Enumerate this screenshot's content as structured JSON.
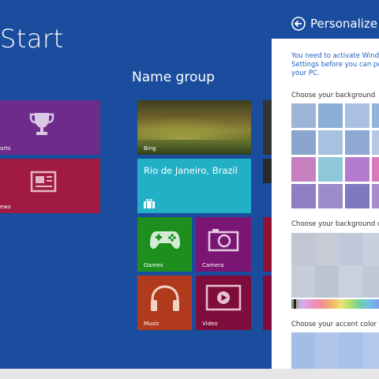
{
  "start": {
    "title": "Start",
    "group_name": "Name group"
  },
  "tiles": {
    "sports": {
      "label": "orts",
      "color": "#6e2b8c",
      "icon": "trophy-icon"
    },
    "news": {
      "label": "ews",
      "color": "#a01a43",
      "icon": "newspaper-icon"
    },
    "bing": {
      "label": "Bing"
    },
    "weather": {
      "city": "Rio de Janeiro, Brazil",
      "color": "#21b0c6",
      "icon": "suitcase-icon"
    },
    "games": {
      "label": "Games",
      "color": "#1c8f1f",
      "icon": "gamepad-icon"
    },
    "camera": {
      "label": "Camera",
      "color": "#7a1573",
      "icon": "camera-icon"
    },
    "music": {
      "label": "Music",
      "color": "#b23a1c",
      "icon": "headphones-icon"
    },
    "video": {
      "label": "Video",
      "color": "#7e0d3c",
      "icon": "play-icon"
    }
  },
  "personalize": {
    "title": "Personalize",
    "warning_lines": [
      "You need to activate Windo",
      "Settings before you can pe",
      "your PC."
    ],
    "background_label": "Choose your background",
    "background_color_label": "Choose your background co",
    "accent_label": "Choose your accent color"
  },
  "colors": {
    "start_bg": "#1a4d9d",
    "panel_bg": "#ffffff",
    "link_text": "#1e5fc0"
  }
}
